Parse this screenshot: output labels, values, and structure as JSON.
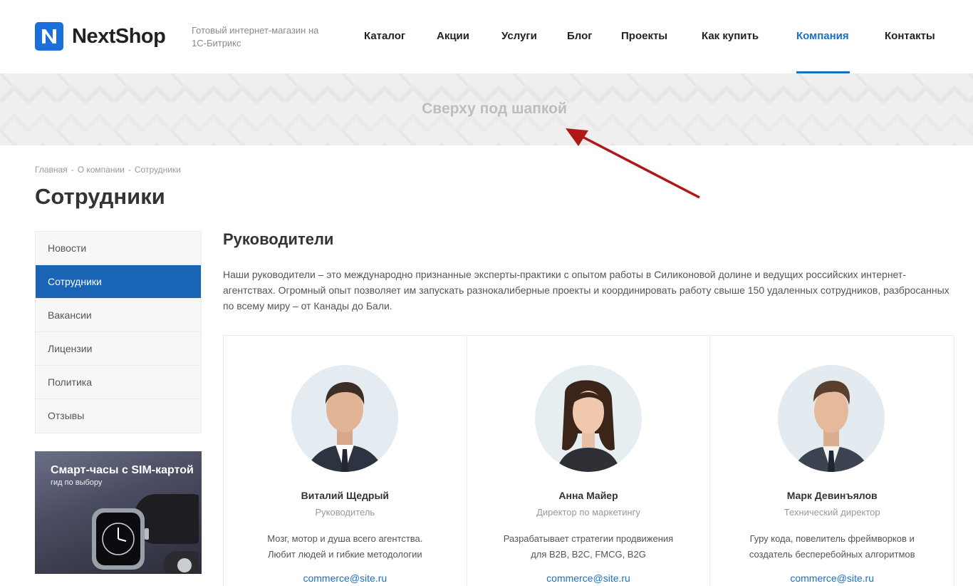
{
  "header": {
    "logo_text": "NextShop",
    "tagline": "Готовый интернет-магазин на 1С-Битрикс",
    "nav": [
      {
        "label": "Каталог"
      },
      {
        "label": "Акции"
      },
      {
        "label": "Услуги"
      },
      {
        "label": "Блог"
      },
      {
        "label": "Проекты"
      },
      {
        "label": "Как купить"
      },
      {
        "label": "Компания",
        "active": true
      },
      {
        "label": "Контакты"
      }
    ]
  },
  "banner": {
    "text": "Сверху под шапкой"
  },
  "breadcrumb": {
    "items": [
      "Главная",
      "О компании",
      "Сотрудники"
    ],
    "separator": "-"
  },
  "page_title": "Сотрудники",
  "sidebar": {
    "items": [
      {
        "label": "Новости"
      },
      {
        "label": "Сотрудники",
        "active": true
      },
      {
        "label": "Вакансии"
      },
      {
        "label": "Лицензии"
      },
      {
        "label": "Политика"
      },
      {
        "label": "Отзывы"
      }
    ],
    "promo": {
      "title": "Смарт-часы с SIM-картой",
      "subtitle": "гид по выбору"
    }
  },
  "main": {
    "section_title": "Руководители",
    "intro": "Наши руководители – это международно признанные эксперты-практики с опытом работы в Силиконовой долине и ведущих российских интернет-агентствах. Огромный опыт позволяет им запускать разнокалиберные проекты и координировать работу свыше 150 удаленных сотрудников, разбросанных по всему миру – от Канады до Бали.",
    "team": [
      {
        "name": "Виталий Щедрый",
        "role": "Руководитель",
        "desc_line1": "Мозг, мотор и душа всего агентства.",
        "desc_line2": "Любит людей и гибкие методологии",
        "email": "commerce@site.ru"
      },
      {
        "name": "Анна Майер",
        "role": "Директор по маркетингу",
        "desc_line1": "Разрабатывает стратегии продвижения",
        "desc_line2": "для B2B, B2C, FMCG, B2G",
        "email": "commerce@site.ru"
      },
      {
        "name": "Марк Девинъялов",
        "role": "Технический директор",
        "desc_line1": "Гуру кода, повелитель фреймворков и",
        "desc_line2": "создатель бесперебойных алгоритмов",
        "email": "commerce@site.ru"
      }
    ]
  },
  "colors": {
    "accent": "#1a6fc4",
    "sidebar_active": "#1a64b5",
    "logo": "#1a6fdb",
    "arrow": "#b01818"
  }
}
